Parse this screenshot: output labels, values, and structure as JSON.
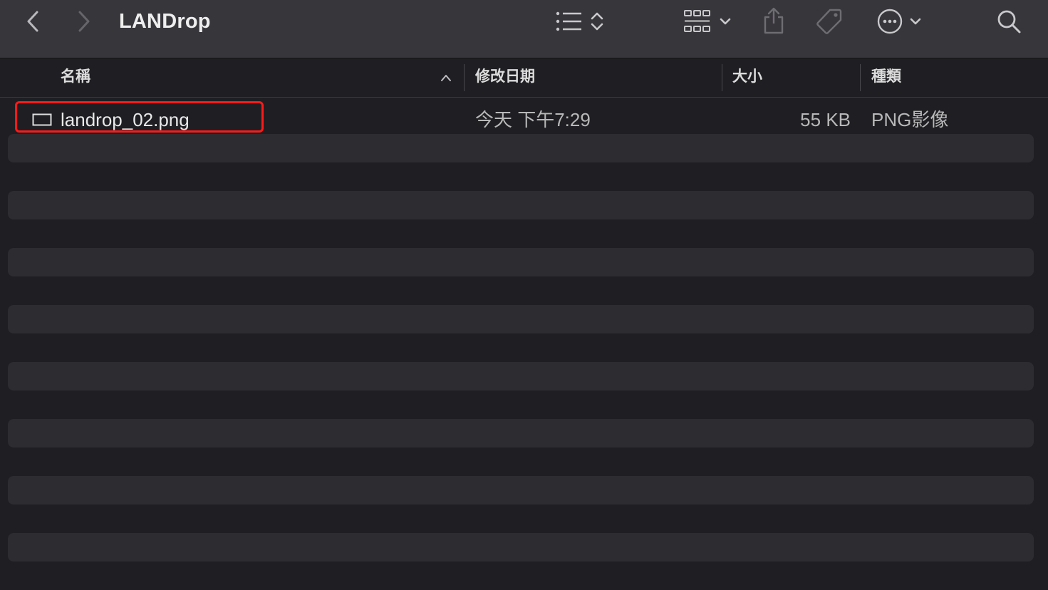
{
  "window": {
    "title": "LANDrop"
  },
  "toolbar": {
    "icons": [
      "back-chevron-icon",
      "forward-chevron-icon",
      "list-view-icon",
      "group-grid-icon",
      "share-icon",
      "tag-icon",
      "more-actions-icon",
      "search-icon"
    ]
  },
  "columns": {
    "name": "名稱",
    "date_modified": "修改日期",
    "size": "大小",
    "kind": "種類"
  },
  "files": [
    {
      "name": "landrop_02.png",
      "date_modified": "今天 下午7:29",
      "size": "55 KB",
      "kind": "PNG影像"
    }
  ],
  "colors": {
    "toolbar_bg": "#37363b",
    "window_bg": "#1f1f23",
    "stripe_bg": "#2c2c31",
    "highlight": "#ff1a1a"
  }
}
